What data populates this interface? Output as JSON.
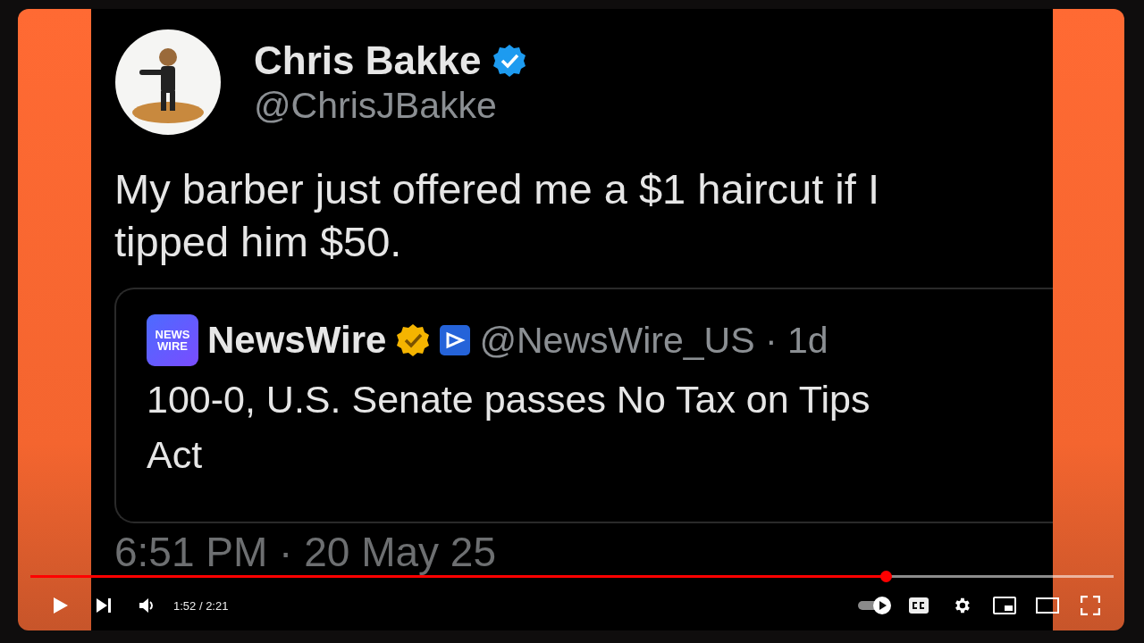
{
  "video": {
    "tweet": {
      "author": "Chris Bakke",
      "verified": true,
      "handle": "@ChrisJBakke",
      "text": "My barber just offered me a $1 haircut if I tipped him $50.",
      "quote": {
        "logo_text": "NEWS WIRE",
        "author": "NewsWire",
        "verified": true,
        "handle": "@NewsWire_US · 1d",
        "text": "100-0, U.S. Senate passes No Tax on Tips Act"
      },
      "timestamp": "6:51 PM · 20 May 25"
    }
  },
  "player": {
    "progress": {
      "level": 0.79
    },
    "time": "1:52 / 2:21",
    "autoplay": {
      "on": true
    }
  }
}
